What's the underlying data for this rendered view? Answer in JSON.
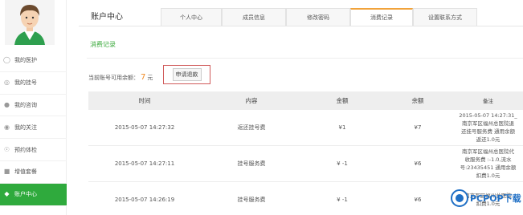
{
  "sidebar": {
    "items": [
      {
        "label": "我的医护",
        "icon": "user-icon",
        "active": false
      },
      {
        "label": "我的挂号",
        "icon": "register-icon",
        "active": false
      },
      {
        "label": "我的咨询",
        "icon": "chat-icon",
        "active": false
      },
      {
        "label": "我的关注",
        "icon": "eye-icon",
        "active": false
      },
      {
        "label": "预约体检",
        "icon": "checkup-icon",
        "active": false
      },
      {
        "label": "增值套餐",
        "icon": "package-icon",
        "active": false
      },
      {
        "label": "账户中心",
        "icon": "wallet-icon",
        "active": true
      }
    ]
  },
  "header": {
    "title": "账户中心",
    "tabs": [
      {
        "label": "个人中心",
        "active": false
      },
      {
        "label": "成员信息",
        "active": false
      },
      {
        "label": "修改密码",
        "active": false
      },
      {
        "label": "消费记录",
        "active": true
      },
      {
        "label": "设置联系方式",
        "active": false
      }
    ]
  },
  "section": {
    "title": "消费记录"
  },
  "balance": {
    "label": "当前账号可用余额：",
    "value": "7",
    "unit": "元",
    "refund_button": "申请退款"
  },
  "table": {
    "headers": [
      "时间",
      "内容",
      "金额",
      "余额",
      "备注"
    ],
    "rows": [
      {
        "time": "2015-05-07 14:27:32",
        "content": "返还挂号费",
        "amount": "¥1",
        "balance": "¥7",
        "note": [
          "2015-05-07 14:27:31_",
          "南京军区福州总医院退",
          "还挂号服务费 通用余额",
          "返还1.0元"
        ]
      },
      {
        "time": "2015-05-07 14:27:11",
        "content": "挂号服务费",
        "amount": "¥ -1",
        "balance": "¥6",
        "note": [
          "南京军区福州总医院代",
          "收服务费 :-1.0,流水",
          "号:23435451 通用余额",
          "扣费1.0元"
        ]
      },
      {
        "time": "2015-05-07 14:26:19",
        "content": "挂号服务费",
        "amount": "¥ -1",
        "balance": "¥6",
        "note": [
          "南京军区福州总医院",
          "扣费1.0元"
        ]
      }
    ]
  },
  "watermark": {
    "text": "PCPOP下载"
  },
  "colors": {
    "accent_green": "#2faa3d",
    "orange": "#f08a24",
    "tab_accent": "#f1a33b",
    "refund_border": "#d05a5a"
  }
}
